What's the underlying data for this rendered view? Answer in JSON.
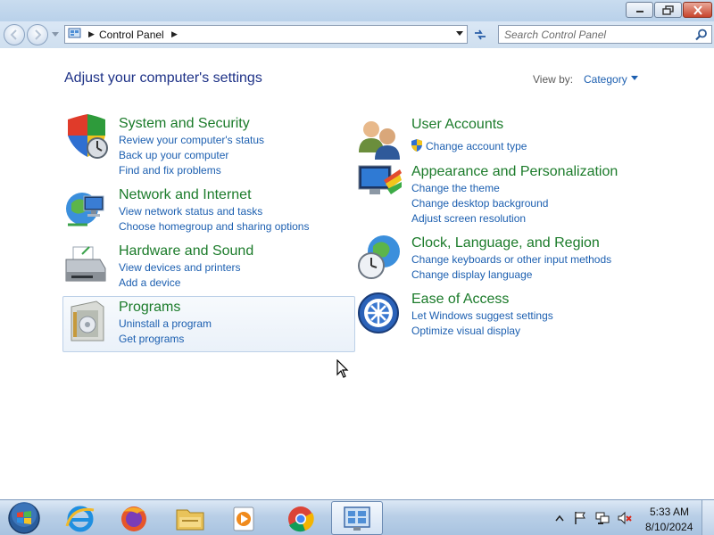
{
  "window": {
    "address_location": "Control Panel",
    "search_placeholder": "Search Control Panel"
  },
  "header": {
    "title": "Adjust your computer's settings",
    "view_by_label": "View by:",
    "view_by_value": "Category"
  },
  "categories": [
    {
      "title": "System and Security",
      "links": [
        "Review your computer's status",
        "Back up your computer",
        "Find and fix problems"
      ]
    },
    {
      "title": "Network and Internet",
      "links": [
        "View network status and tasks",
        "Choose homegroup and sharing options"
      ]
    },
    {
      "title": "Hardware and Sound",
      "links": [
        "View devices and printers",
        "Add a device"
      ]
    },
    {
      "title": "Programs",
      "links": [
        "Uninstall a program",
        "Get programs"
      ]
    },
    {
      "title": "User Accounts",
      "links": [
        "Change account type"
      ]
    },
    {
      "title": "Appearance and Personalization",
      "links": [
        "Change the theme",
        "Change desktop background",
        "Adjust screen resolution"
      ]
    },
    {
      "title": "Clock, Language, and Region",
      "links": [
        "Change keyboards or other input methods",
        "Change display language"
      ]
    },
    {
      "title": "Ease of Access",
      "links": [
        "Let Windows suggest settings",
        "Optimize visual display"
      ]
    }
  ],
  "taskbar": {
    "items": [
      "start-orb",
      "internet-explorer-icon",
      "firefox-icon",
      "file-explorer-icon",
      "media-player-icon",
      "chrome-icon",
      "control-panel-icon"
    ],
    "active_item": "control-panel-icon",
    "clock_time": "5:33 AM",
    "clock_date": "8/10/2024"
  },
  "colors": {
    "category_title": "#1b7b2a",
    "link": "#1c5fb0",
    "page_title": "#1e3287"
  }
}
